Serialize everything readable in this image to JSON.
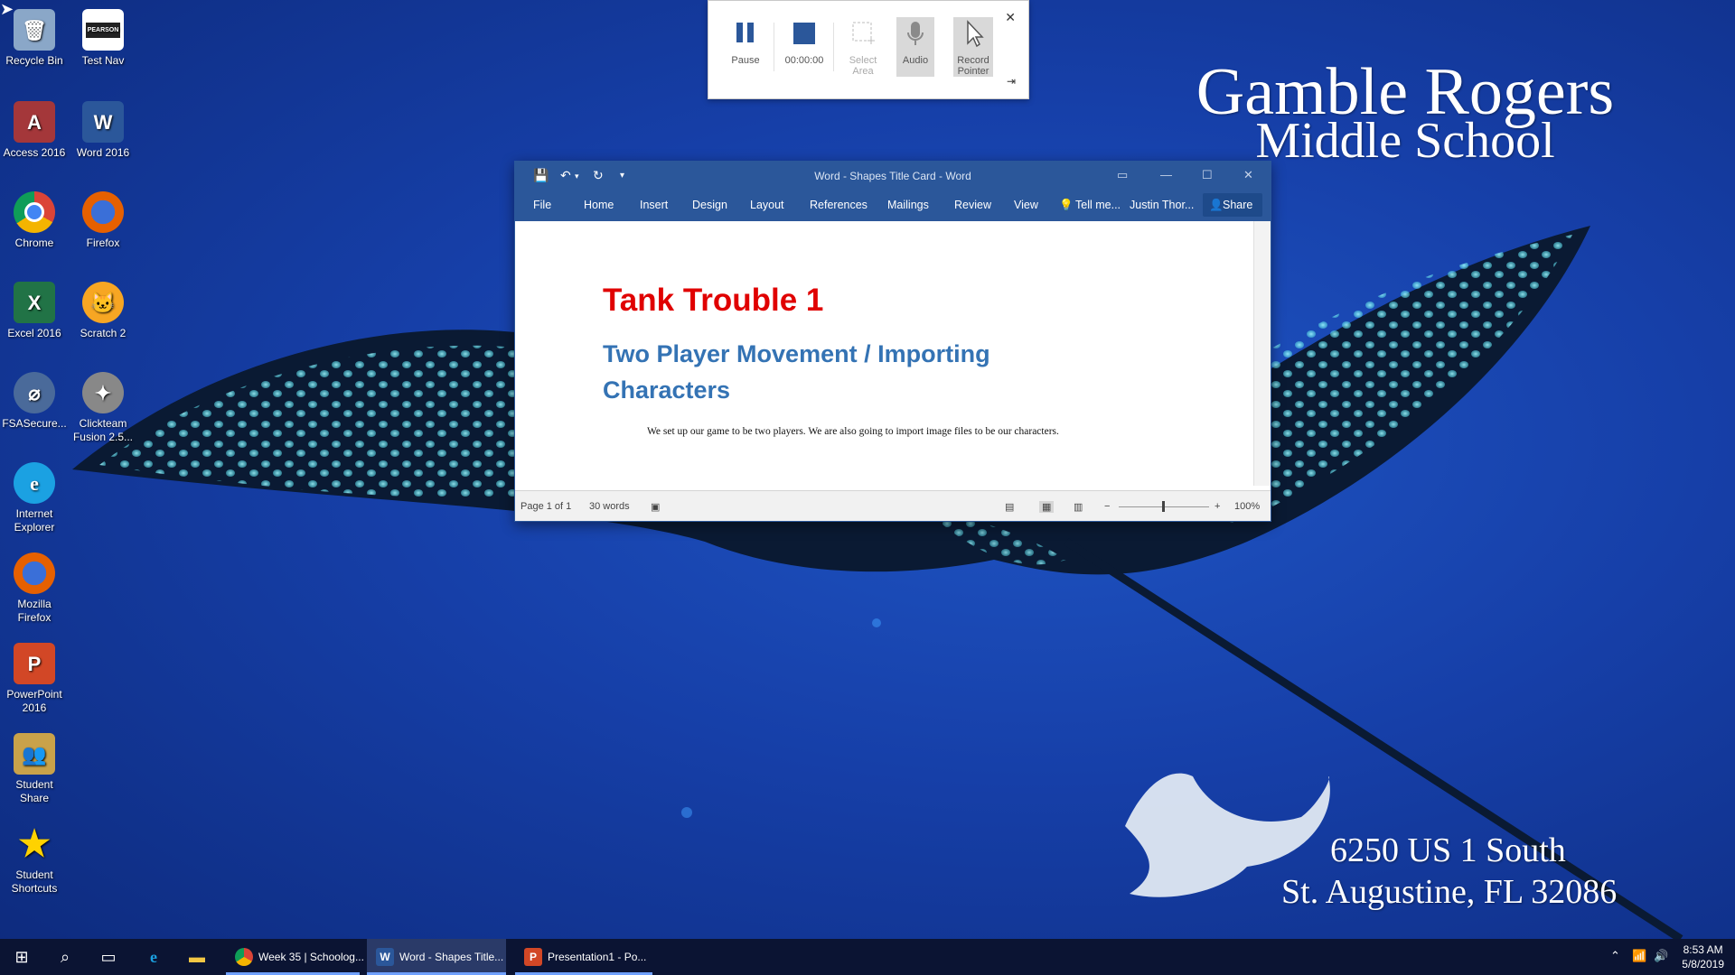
{
  "wallpaper": {
    "school_line1": "Gamble Rogers",
    "school_line2": "Middle School",
    "address_line1": "6250 US 1 South",
    "address_line2": "St. Augustine, FL 32086"
  },
  "desktop_icons": [
    {
      "label": "Recycle Bin",
      "icon": "recycle-bin-icon",
      "color": "#8aa7c8"
    },
    {
      "label": "Test Nav",
      "icon": "testnav-icon",
      "color": "#ffffff"
    },
    {
      "label": "Access 2016",
      "icon": "access-icon",
      "color": "#a4373a"
    },
    {
      "label": "Word 2016",
      "icon": "word-icon",
      "color": "#2b579a"
    },
    {
      "label": "Chrome",
      "icon": "chrome-icon",
      "color": "#db4437"
    },
    {
      "label": "Firefox",
      "icon": "firefox-icon",
      "color": "#e66000"
    },
    {
      "label": "Excel 2016",
      "icon": "excel-icon",
      "color": "#217346"
    },
    {
      "label": "Scratch 2",
      "icon": "scratch-icon",
      "color": "#f7a623"
    },
    {
      "label": "FSASecure...",
      "icon": "fsasecure-icon",
      "color": "#4a6a9a"
    },
    {
      "label": "Clickteam Fusion 2.5...",
      "icon": "clickteam-icon",
      "color": "#888888"
    },
    {
      "label": "Internet Explorer",
      "icon": "internet-explorer-icon",
      "color": "#1ba1e2"
    },
    {
      "label": "Mozilla Firefox",
      "icon": "mozilla-firefox-icon",
      "color": "#e66000"
    },
    {
      "label": "PowerPoint 2016",
      "icon": "powerpoint-icon",
      "color": "#d24726"
    },
    {
      "label": "Student Share",
      "icon": "student-share-icon",
      "color": "#c9a24a"
    },
    {
      "label": "Student Shortcuts",
      "icon": "star-icon",
      "color": "#ffd200"
    }
  ],
  "testnav_badge": "PEARSON",
  "recorder": {
    "pause": "Pause",
    "timer": "00:00:00",
    "select_area": "Select Area",
    "audio": "Audio",
    "record_pointer": "Record Pointer"
  },
  "word": {
    "title": "Word - Shapes Title Card - Word",
    "tabs": [
      "File",
      "Home",
      "Insert",
      "Design",
      "Layout",
      "References",
      "Mailings",
      "Review",
      "View"
    ],
    "tell_me": "Tell me...",
    "user": "Justin Thor...",
    "share": "Share",
    "doc_heading": "Tank Trouble 1",
    "doc_subheading": "Two Player Movement / Importing Characters",
    "doc_body": "We set up our game to be two players.  We are also going to import image files to be our characters.",
    "status_page": "Page 1 of 1",
    "status_words": "30 words",
    "zoom": "100%"
  },
  "taskbar": {
    "apps": [
      {
        "label": "Week 35 | Schoolog...",
        "icon": "chrome-icon"
      },
      {
        "label": "Word - Shapes Title...",
        "icon": "word-icon"
      },
      {
        "label": "Presentation1 - Po...",
        "icon": "powerpoint-icon"
      }
    ],
    "time": "8:53 AM",
    "date": "5/8/2019"
  },
  "colors": {
    "word_blue": "#2b579a",
    "heading_red": "#e00000",
    "subheading_blue": "#3473b4",
    "taskbar": "#0b1433"
  }
}
